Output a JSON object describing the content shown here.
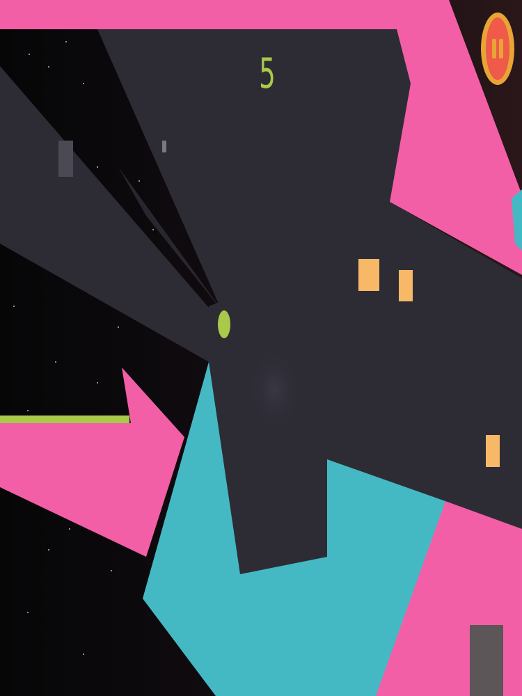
{
  "hud": {
    "score": "5",
    "pause_icon": "pause-icon"
  },
  "colors": {
    "background": "#0b0a0d",
    "beam": "#2d2c35",
    "pink": "#f35fa6",
    "teal": "#45b9c3",
    "orange": "#f7b868",
    "green": "#a9c94b",
    "pause_outer": "#e8a535",
    "pause_inner": "#ef5a49"
  }
}
